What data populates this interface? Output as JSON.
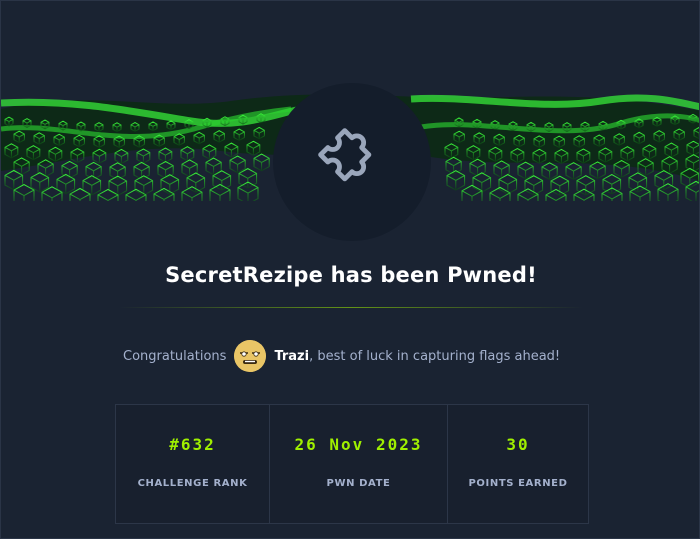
{
  "machine": {
    "title": "SecretRezipe has been Pwned!"
  },
  "congrats": {
    "prefix": "Congratulations",
    "username": "Trazi",
    "suffix": ", best of luck in capturing flags ahead!"
  },
  "stats": [
    {
      "value": "#632",
      "label": "CHALLENGE RANK"
    },
    {
      "value": "26 Nov 2023",
      "label": "PWN DATE"
    },
    {
      "value": "30",
      "label": "POINTS EARNED"
    }
  ],
  "colors": {
    "background": "#1a2332",
    "accent_green": "#9fef00",
    "badge_bg": "#141d2b",
    "text_muted": "#a4b1cd"
  },
  "icons": {
    "badge": "puzzle-piece-icon",
    "banner": "green-cube-wave-background"
  }
}
